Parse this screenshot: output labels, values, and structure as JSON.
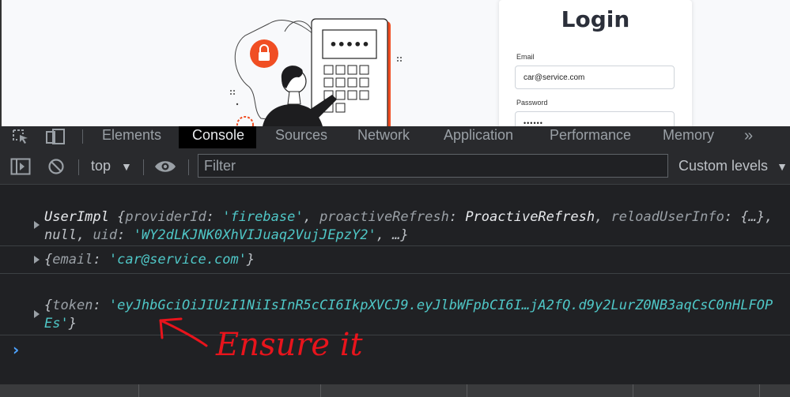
{
  "login": {
    "title": "Login",
    "email_label": "Email",
    "email_value": "car@service.com",
    "password_label": "Password",
    "password_value": "••••••",
    "illustration_pin": "•••••"
  },
  "devtools": {
    "tabs": [
      "Elements",
      "Console",
      "Sources",
      "Network",
      "Application",
      "Performance",
      "Memory"
    ],
    "more_tabs": "»",
    "active_tab": "Console",
    "context": "top",
    "filter_placeholder": "Filter",
    "levels": "Custom levels"
  },
  "console": {
    "msg1": {
      "type": "UserImpl",
      "provider_key": "providerId",
      "provider_val": "'firebase'",
      "refresh_key": "proactiveRefresh",
      "refresh_val": "ProactiveRefresh",
      "reload_key": "reloadUserInfo",
      "reload_val": "{…}",
      "null_text": "null",
      "uid_key": "uid",
      "uid_val": "'WY2dLKJNK0XhVIJuaq2VujJEpzY2'",
      "ellipsis": "…"
    },
    "msg2": {
      "key": "email",
      "val": "'car@service.com'"
    },
    "msg3": {
      "key": "token",
      "val_line1": "'eyJhbGciOiJIUzI1NiIsInR5cCI6IkpXVCJ9.eyJlbWFpbCI6I…jA2fQ.d9y2LurZ0NB3aqCsC0nHLFOP",
      "val_line2": "Es'"
    },
    "prompt": "›"
  },
  "annotation": {
    "text": "Ensure it",
    "color": "#e8141c"
  }
}
